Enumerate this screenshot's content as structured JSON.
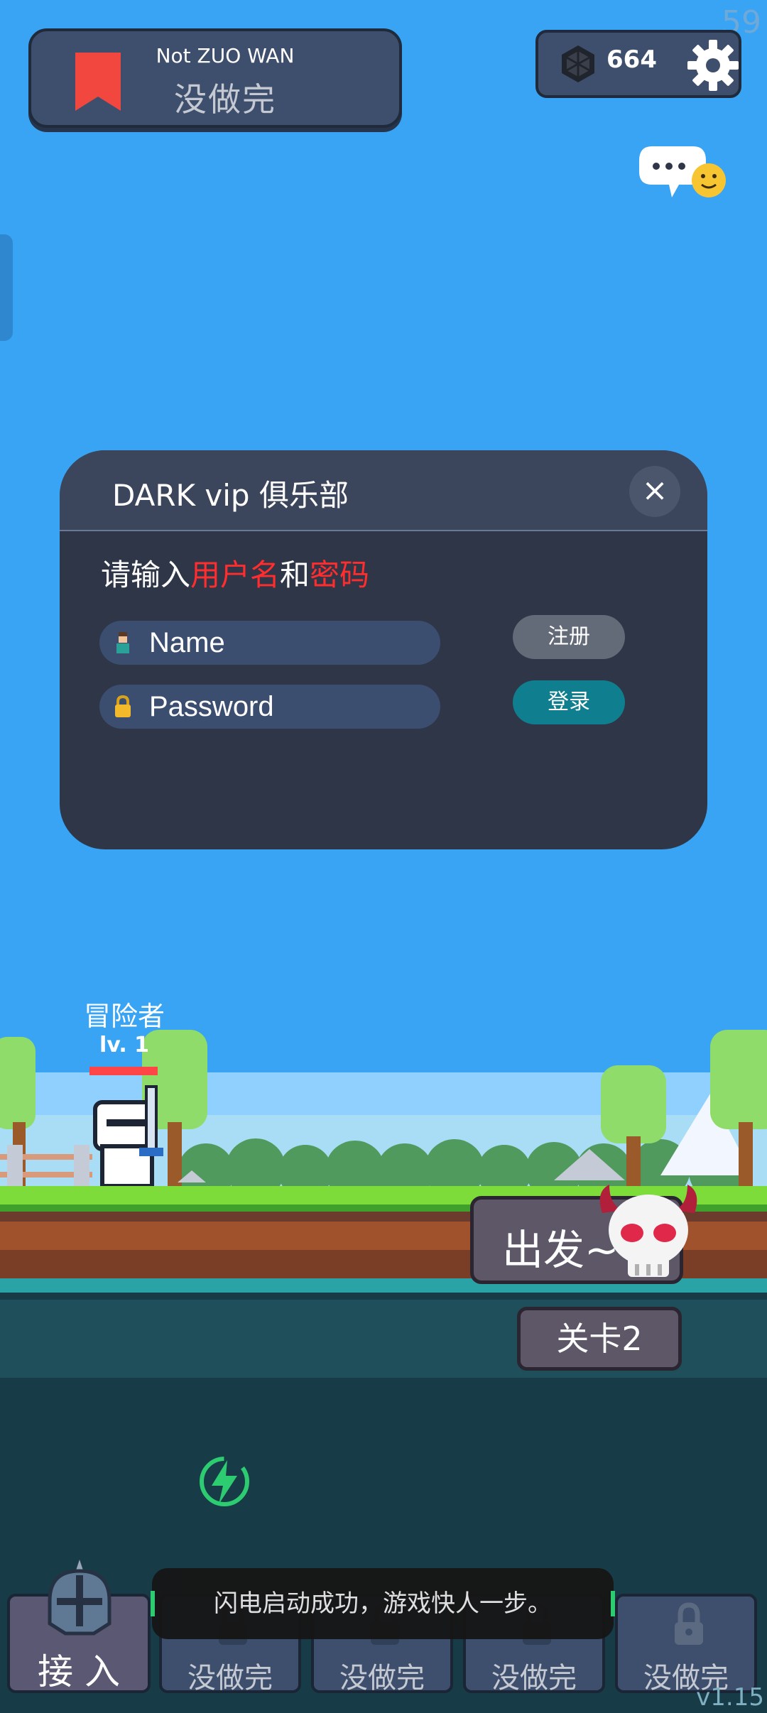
{
  "top_banner": {
    "subtitle": "Not ZUO WAN",
    "title": "没做完"
  },
  "currency": {
    "amount": "664"
  },
  "fps_counter": "59",
  "dialog": {
    "title": "DARK vip 俱乐部",
    "close_label": "×",
    "prompt_a": "请输入",
    "prompt_b": "用户名",
    "prompt_c": "和",
    "prompt_d": "密码",
    "name_placeholder": "Name",
    "password_placeholder": "Password",
    "register_label": "注册",
    "login_label": "登录"
  },
  "hero": {
    "name": "冒险者",
    "level": "lv. 1"
  },
  "actions": {
    "go_label": "出发~",
    "level_label": "关卡2"
  },
  "bottom_nav": {
    "items": [
      {
        "label": "接 入"
      },
      {
        "label": "没做完"
      },
      {
        "label": "没做完"
      },
      {
        "label": "没做完"
      },
      {
        "label": "没做完"
      }
    ]
  },
  "toast": "闪电启动成功，游戏快人一步。",
  "version": "v1.15",
  "colors": {
    "sky": "#3aa4f4",
    "panel": "#3e4f6e",
    "accent_red": "#ff2d2d",
    "login_teal": "#0f7f8f",
    "bolt_green": "#2ecc71"
  }
}
